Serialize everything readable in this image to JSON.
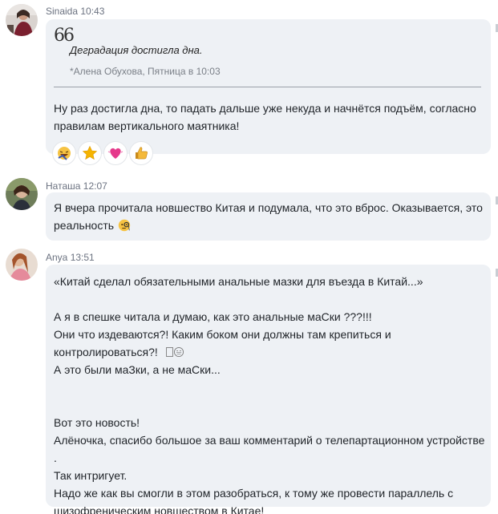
{
  "messages": [
    {
      "author": "Sinaida",
      "time": "10:43",
      "quote": {
        "mark": "66",
        "text": "Деградация достигла дна.",
        "source": "*Алена Обухова, Пятница в 10:03"
      },
      "lines": [
        "Ну раз достигла дна, то падать дальше уже некуда и начнётся подъём, согласно",
        "правилам вертикального маятника!"
      ],
      "reactions": [
        "laughing-icon",
        "star-icon",
        "heart-icon",
        "thumbs-up-icon"
      ]
    },
    {
      "author": "Наташа",
      "time": "12:07",
      "lines": [
        "Я вчера прочитала новшество Китая и подумала, что это вброс. Оказывается, это",
        "реальность"
      ],
      "inline_icon": "monocle-face-icon"
    },
    {
      "author": "Anya",
      "time": "13:51",
      "lines": [
        "«Китай сделал обязательными анальные мазки для въезда в Китай...»",
        "",
        "А я в спешке читала и думаю, как это анальные маСки ???!!!",
        "Они что издеваются?! Каким боком они должны там крепиться и",
        "контролироваться?!",
        "А это были маЗки, а не маСки...",
        "",
        "",
        "Вот это новость!",
        "Алёночка, спасибо большое за ваш комментарий о телепартационном устройстве .",
        "Так интригует.",
        "Надо же как вы смогли в этом разобраться, к тому же провести параллель с",
        "шизофреническим новшеством в Китае!"
      ],
      "inline_icon": "grinning-face-icon"
    }
  ],
  "colors": {
    "bubble": "#eef1f5",
    "meta": "#6b7280",
    "text": "#1f2328"
  }
}
